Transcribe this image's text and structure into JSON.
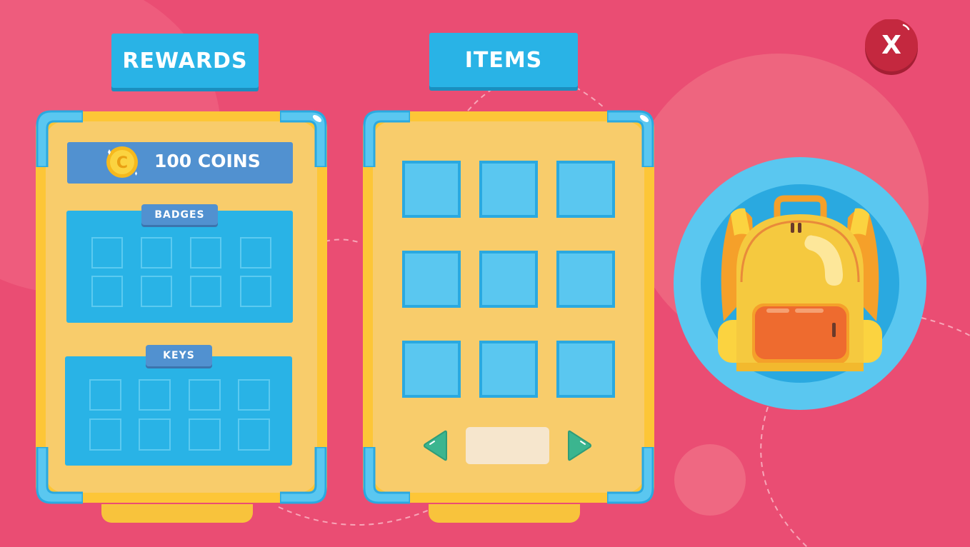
{
  "screen": {
    "rewards_title": "REWARDS",
    "items_title": "ITEMS",
    "close_label": "X"
  },
  "rewards": {
    "coins_text": "100 COINS",
    "coin_letter": "C",
    "badges_label": "BADGES",
    "keys_label": "KEYS"
  },
  "items": {
    "page_value": ""
  },
  "colors": {
    "background": "#ea4d73",
    "header_blue": "#29b3e6",
    "panel_yellow": "#fdc637",
    "panel_inner": "#f8cc6b",
    "slot_blue": "#5ac7f0",
    "close_red": "#c4283f",
    "arrow_green": "#3bb58f"
  },
  "icons": {
    "coin": "coin-icon",
    "backpack": "backpack-icon",
    "prev": "arrow-left-icon",
    "next": "arrow-right-icon",
    "close": "close-icon"
  }
}
